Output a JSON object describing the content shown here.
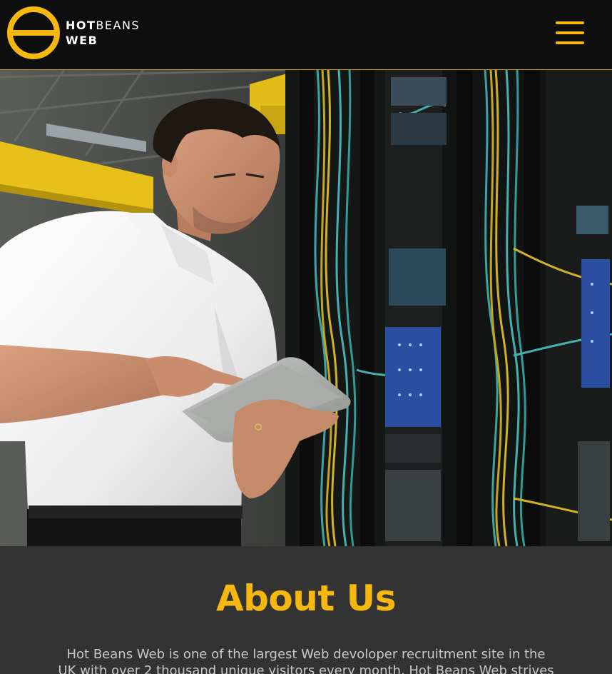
{
  "header": {
    "logo": {
      "word_hot": "HOT",
      "word_beans": "BEANS",
      "word_web": "WEB"
    },
    "menu_icon": "hamburger-menu-icon"
  },
  "hero": {
    "image_description": "technician-with-tablet-in-server-room"
  },
  "about": {
    "title": "About Us",
    "text": "Hot Beans Web is one of the largest Web devoloper recruitment site in the UK with over 2 thousand unique visitors every month. Hot Beans Web strives to put"
  },
  "colors": {
    "accent": "#f6b80e",
    "header_bg": "#0e0e0e",
    "body_bg": "#333333",
    "text": "#c9c9c9"
  }
}
